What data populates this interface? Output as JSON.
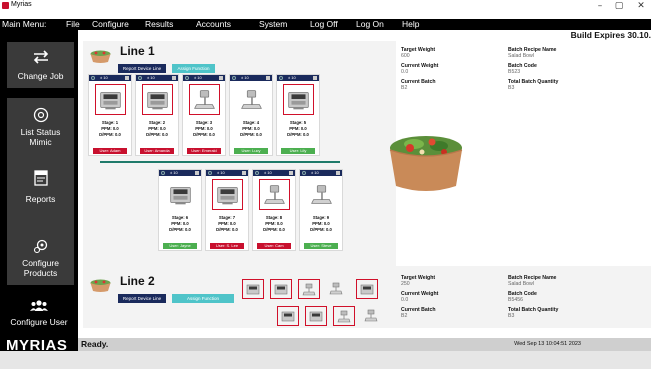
{
  "window": {
    "title": "Myrias",
    "minimize_glyph": "–",
    "maximize_glyph": "▢",
    "close_glyph": "✕"
  },
  "menu": {
    "label": "Main Menu:",
    "items": [
      "File",
      "Configure",
      "Results",
      "Accounts",
      "System",
      "Log Off",
      "Log On",
      "Help"
    ]
  },
  "sidebar": {
    "items": [
      {
        "label": "Change Job",
        "icon": "swap-arrows-icon"
      },
      {
        "label_line1": "List Status",
        "label_line2": "Mimic",
        "icon": "status-gauge-icon"
      },
      {
        "label": "Reports",
        "icon": "report-document-icon"
      },
      {
        "label_line1": "Configure",
        "label_line2": "Products",
        "icon": "configure-gears-icon"
      },
      {
        "label": "Configure User",
        "icon": "users-group-icon"
      }
    ],
    "brand": "MYRIAS"
  },
  "header": {
    "expires": "Build Expires 30.10."
  },
  "line1": {
    "title": "Line 1",
    "report_button": "Report Device Line",
    "assign_button": "Assign Function",
    "head_value": "± 10",
    "stages": [
      {
        "stage": "Stage: 1",
        "ppm": "PPM: 0.0",
        "dppm": "D/PPM: 0.0",
        "user": "User: Adam",
        "status": "red",
        "alert": true,
        "device": "scale-display"
      },
      {
        "stage": "Stage: 2",
        "ppm": "PPM: 0.0",
        "dppm": "D/PPM: 0.0",
        "user": "User: Amanda",
        "status": "red",
        "alert": true,
        "device": "scale-display"
      },
      {
        "stage": "Stage: 3",
        "ppm": "PPM: 0.0",
        "dppm": "D/PPM: 0.0",
        "user": "User: Emerald",
        "status": "red",
        "alert": true,
        "device": "scale-platform"
      },
      {
        "stage": "Stage: 4",
        "ppm": "PPM: 0.0",
        "dppm": "D/PPM: 0.0",
        "user": "User: Lucy",
        "status": "green",
        "alert": false,
        "device": "scale-platform"
      },
      {
        "stage": "Stage: 5",
        "ppm": "PPM: 0.0",
        "dppm": "D/PPM: 0.0",
        "user": "User: Lily",
        "status": "green",
        "alert": true,
        "device": "scale-display"
      },
      {
        "stage": "Stage: 6",
        "ppm": "PPM: 0.0",
        "dppm": "D/PPM: 0.0",
        "user": "User: Jayne",
        "status": "green",
        "alert": false,
        "device": "scale-display"
      },
      {
        "stage": "Stage: 7",
        "ppm": "PPM: 0.0",
        "dppm": "D/PPM: 0.0",
        "user": "User: S. Lee",
        "status": "red",
        "alert": true,
        "device": "scale-display"
      },
      {
        "stage": "Stage: 8",
        "ppm": "PPM: 0.0",
        "dppm": "D/PPM: 0.0",
        "user": "User: Cam",
        "status": "red",
        "alert": true,
        "device": "scale-platform"
      },
      {
        "stage": "Stage: 9",
        "ppm": "PPM: 0.0",
        "dppm": "D/PPM: 0.0",
        "user": "User: Steve",
        "status": "green",
        "alert": false,
        "device": "scale-platform"
      }
    ],
    "info": {
      "target_weight_label": "Target Weight",
      "target_weight": "600",
      "current_weight_label": "Current Weight",
      "current_weight": "0.0",
      "current_batch_label": "Current Batch",
      "current_batch": "B2",
      "recipe_label": "Batch Recipe Name",
      "recipe": "Salad Bowl",
      "code_label": "Batch Code",
      "code": "B523",
      "qty_label": "Total Batch Quantity",
      "qty": "B3"
    }
  },
  "line2": {
    "title": "Line 2",
    "report_button": "Report Device Line",
    "assign_button": "Assign Function",
    "devices": [
      {
        "device": "scale-display",
        "alert": true
      },
      {
        "device": "scale-display",
        "alert": true
      },
      {
        "device": "scale-platform",
        "alert": true
      },
      {
        "device": "scale-platform",
        "alert": false
      },
      {
        "device": "scale-display",
        "alert": true
      },
      {
        "device": "scale-display",
        "alert": true
      },
      {
        "device": "scale-display",
        "alert": true
      },
      {
        "device": "scale-platform",
        "alert": true
      },
      {
        "device": "scale-platform",
        "alert": false
      }
    ],
    "info": {
      "target_weight_label": "Target Weight",
      "target_weight": "250",
      "current_weight_label": "Current Weight",
      "current_weight": "0.0",
      "current_batch_label": "Current Batch",
      "current_batch": "B2",
      "recipe_label": "Batch Recipe Name",
      "recipe": "Salad Bowl",
      "code_label": "Batch Code",
      "code": "B5456",
      "qty_label": "Total Batch Quantity",
      "qty": "B3"
    }
  },
  "status": {
    "text": "Ready.",
    "datetime": "Wed Sep 13 10:04:51 2023"
  },
  "colors": {
    "alert": "#d0102a",
    "ok": "#4caf50",
    "navy": "#1a2a5c",
    "teal": "#4fc4c9"
  }
}
